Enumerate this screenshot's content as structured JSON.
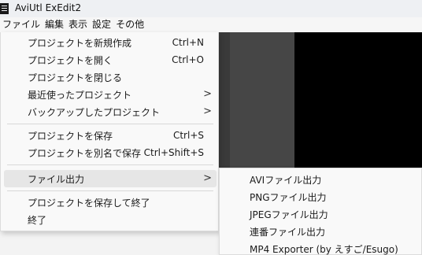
{
  "window": {
    "title": "AviUtl ExEdit2"
  },
  "menubar": {
    "items": [
      "ファイル",
      "編集",
      "表示",
      "設定",
      "その他"
    ]
  },
  "file_menu": {
    "items": [
      {
        "label": "プロジェクトを新規作成",
        "shortcut": "Ctrl+N",
        "arrow": ""
      },
      {
        "label": "プロジェクトを開く",
        "shortcut": "Ctrl+O",
        "arrow": ""
      },
      {
        "label": "プロジェクトを閉じる",
        "shortcut": "",
        "arrow": ""
      },
      {
        "label": "最近使ったプロジェクト",
        "shortcut": "",
        "arrow": ">"
      },
      {
        "label": "バックアップしたプロジェクト",
        "shortcut": "",
        "arrow": ">"
      },
      {
        "label": "プロジェクトを保存",
        "shortcut": "Ctrl+S",
        "arrow": ""
      },
      {
        "label": "プロジェクトを別名で保存",
        "shortcut": "Ctrl+Shift+S",
        "arrow": ""
      },
      {
        "label": "ファイル出力",
        "shortcut": "",
        "arrow": ">"
      },
      {
        "label": "プロジェクトを保存して終了",
        "shortcut": "",
        "arrow": ""
      },
      {
        "label": "終了",
        "shortcut": "",
        "arrow": ""
      }
    ]
  },
  "export_submenu": {
    "items": [
      "AVIファイル出力",
      "PNGファイル出力",
      "JPEGファイル出力",
      "連番ファイル出力",
      "MP4 Exporter (by えすご/Esugo)"
    ]
  },
  "colors": {
    "menu_bg": "#f9f9f9",
    "hover_bg": "#e6e6e6",
    "preview_bg": "#000000"
  }
}
